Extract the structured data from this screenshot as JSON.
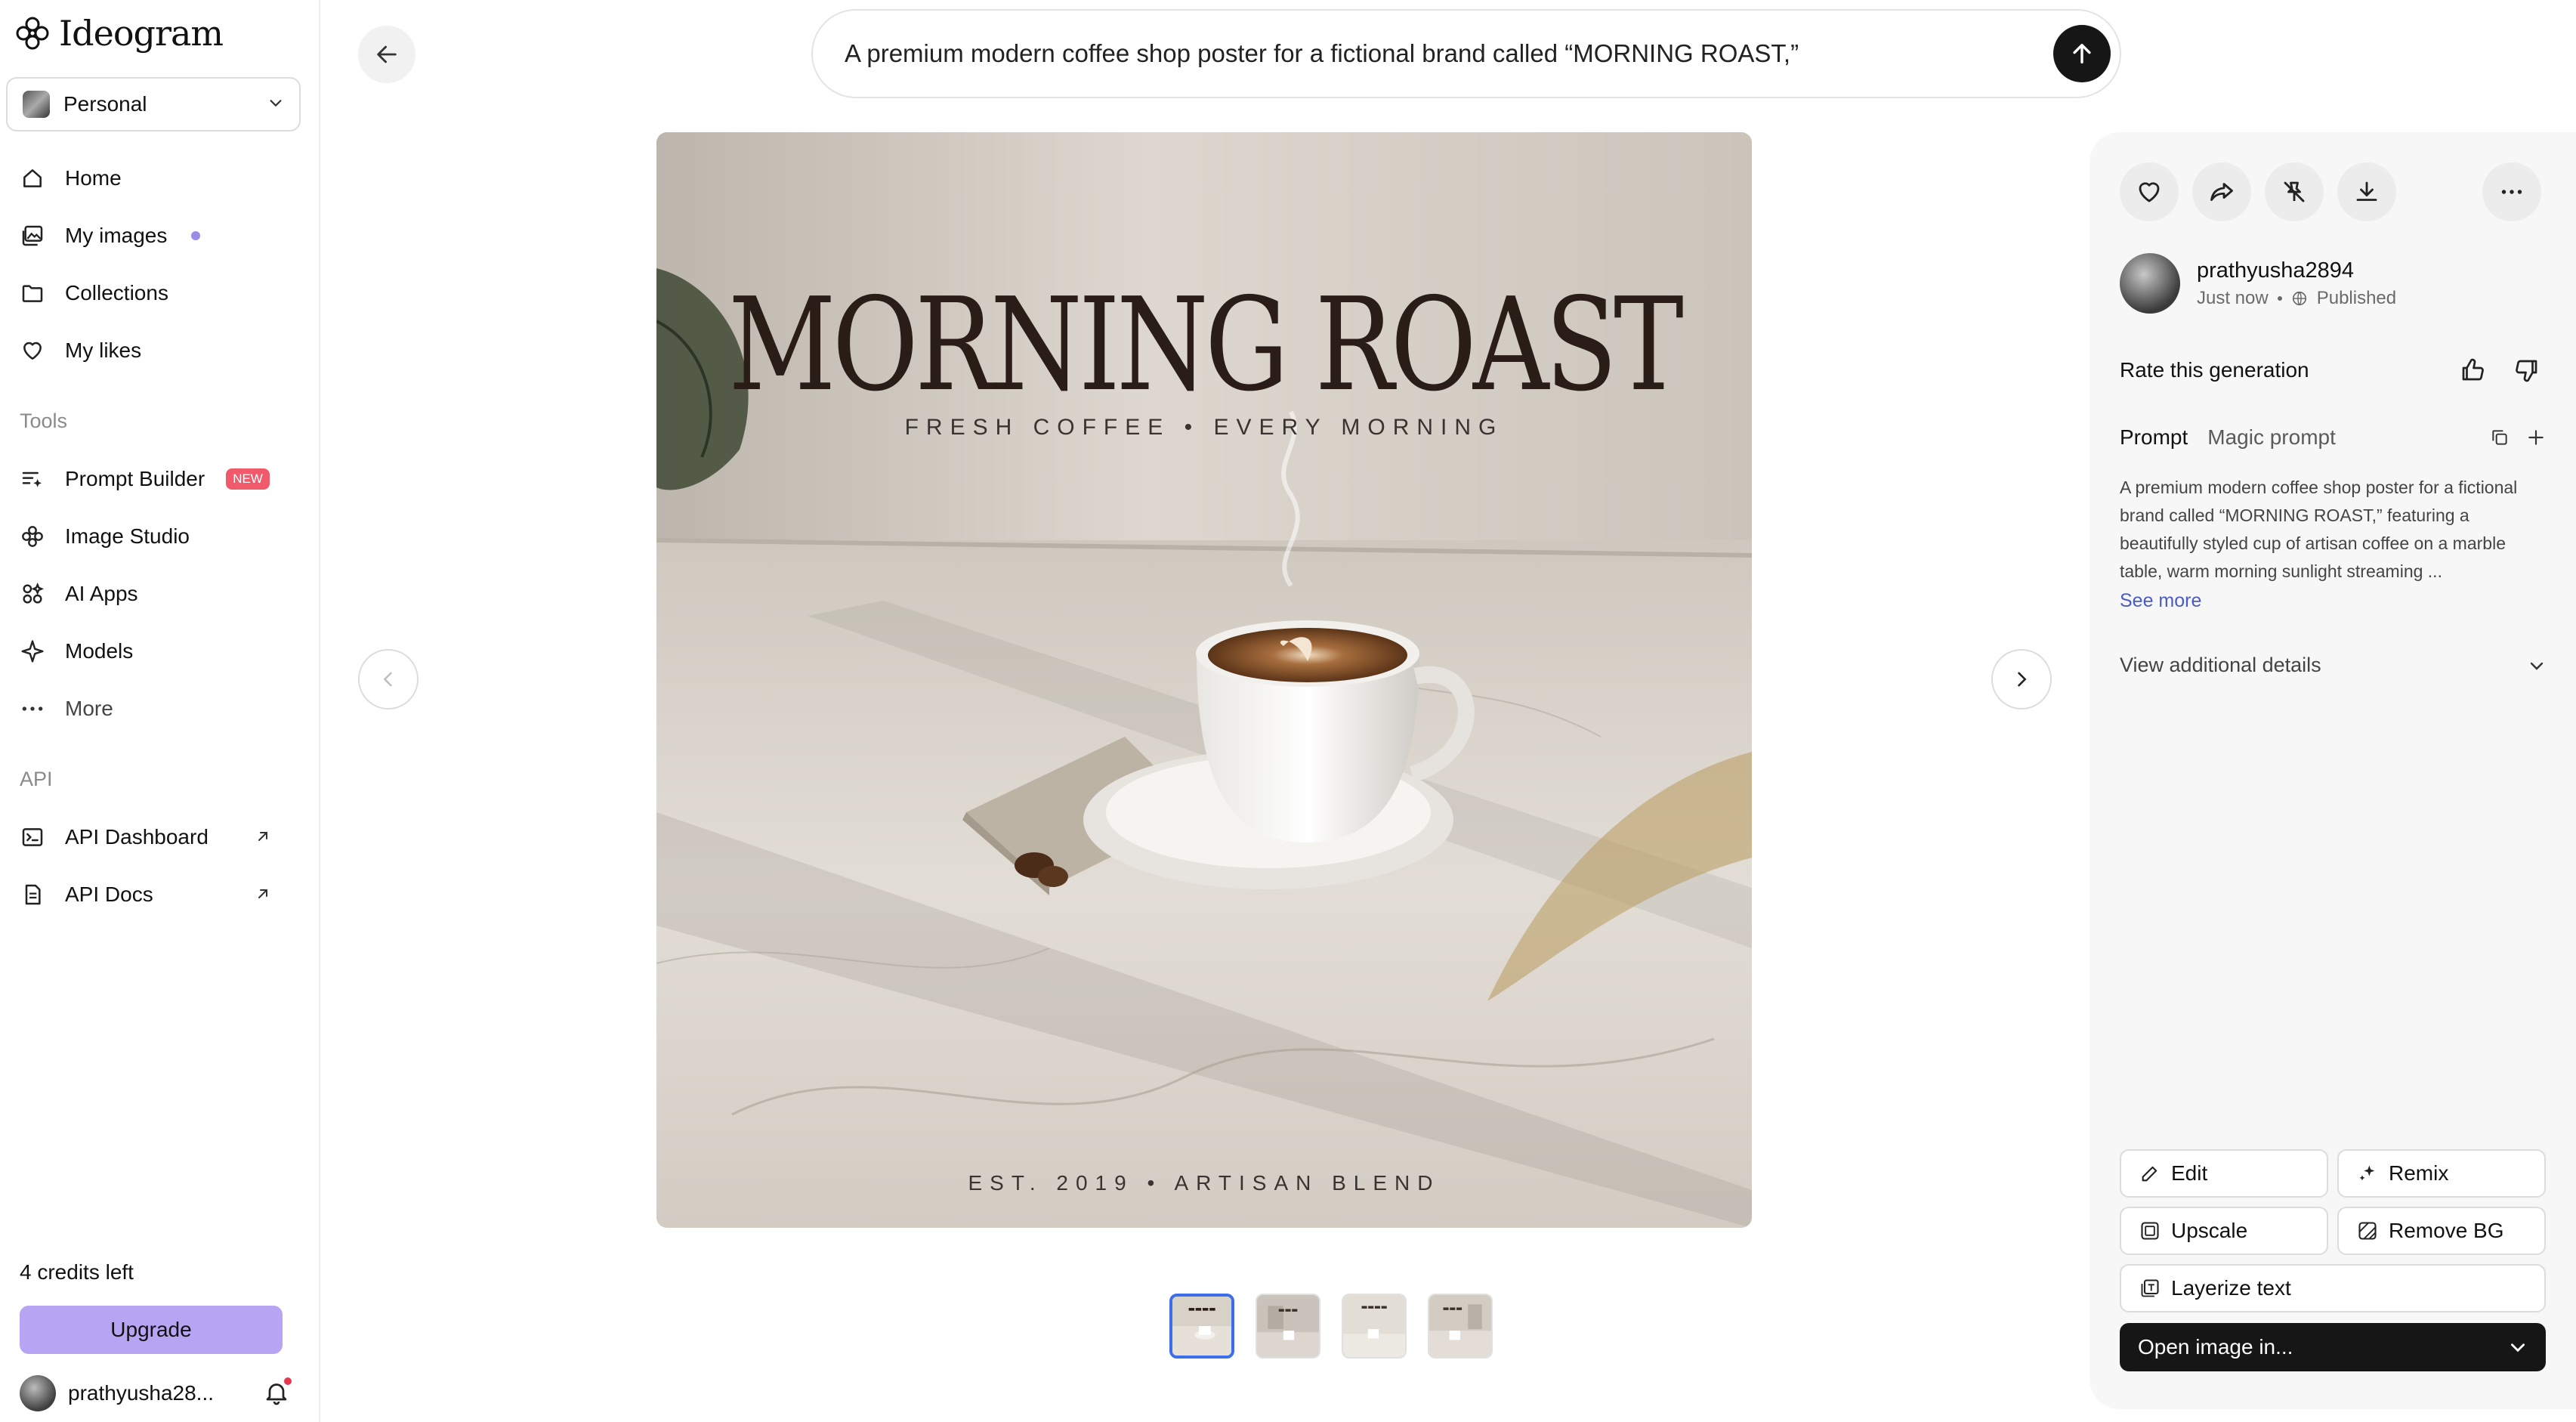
{
  "app": {
    "name": "Ideogram"
  },
  "workspace": {
    "label": "Personal"
  },
  "nav": {
    "home": "Home",
    "my_images": "My images",
    "collections": "Collections",
    "my_likes": "My likes"
  },
  "tools": {
    "section_label": "Tools",
    "prompt_builder": "Prompt Builder",
    "prompt_builder_badge": "NEW",
    "image_studio": "Image Studio",
    "ai_apps": "AI Apps",
    "models": "Models",
    "more": "More"
  },
  "api": {
    "section_label": "API",
    "dashboard": "API Dashboard",
    "docs": "API Docs"
  },
  "account": {
    "credits": "4 credits left",
    "upgrade_label": "Upgrade",
    "username": "prathyusha28..."
  },
  "prompt_bar": {
    "value": "A premium modern coffee shop poster for a fictional brand called “MORNING ROAST,”"
  },
  "poster": {
    "title": "MORNING ROAST",
    "subtitle": "FRESH COFFEE  •  EVERY MORNING",
    "footer": "EST. 2019  •  ARTISAN BLEND"
  },
  "details": {
    "author_name": "prathyusha2894",
    "time": "Just now",
    "visibility": "Published",
    "rate_label": "Rate this generation",
    "tab_prompt": "Prompt",
    "tab_magic": "Magic prompt",
    "prompt_text": "A premium modern coffee shop poster for a fictional brand called “MORNING ROAST,” featuring a beautifully styled cup of artisan coffee on a marble table, warm morning sunlight streaming ...",
    "see_more": "See more",
    "additional": "View additional details"
  },
  "actions": {
    "edit": "Edit",
    "remix": "Remix",
    "upscale": "Upscale",
    "remove_bg": "Remove BG",
    "layerize": "Layerize text",
    "open_in": "Open image in..."
  },
  "colors": {
    "accent_purple": "#b7a4f2",
    "active_thumb": "#3b6ee8",
    "badge_new": "#f05a6b",
    "link": "#4a5bc4"
  }
}
